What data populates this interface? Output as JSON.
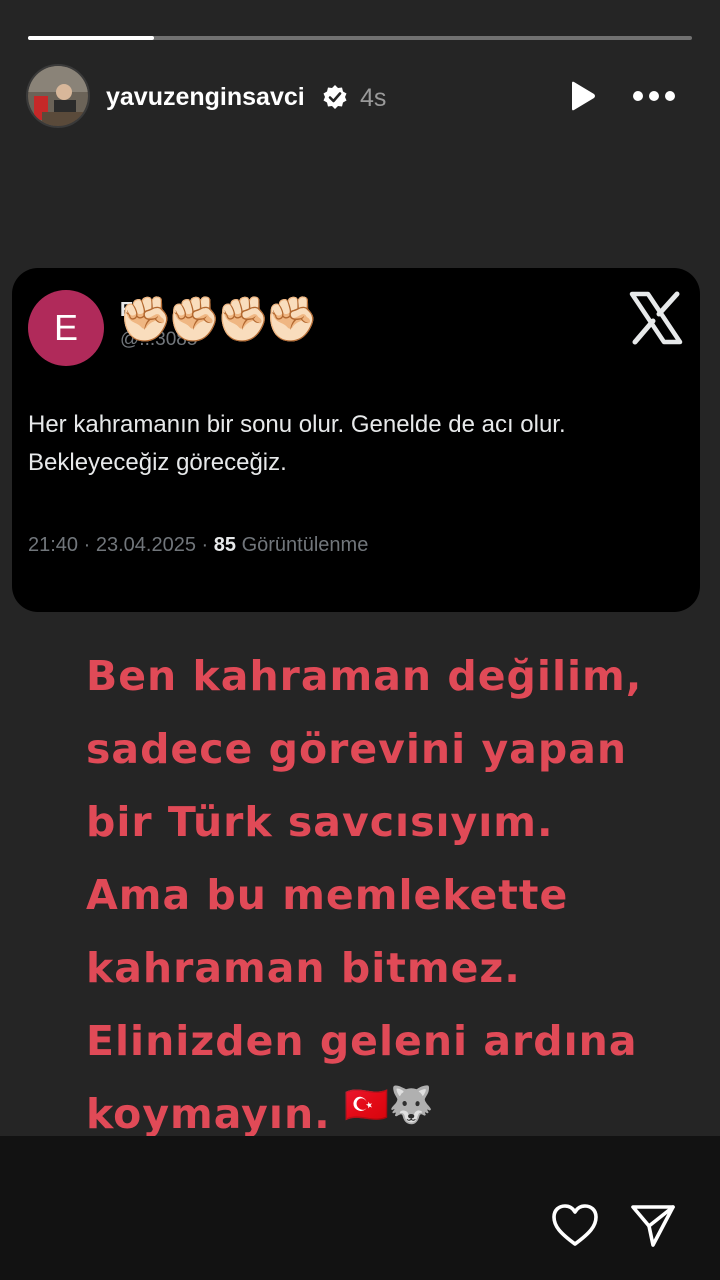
{
  "story": {
    "progress": 0.19,
    "username": "yavuzenginsavci",
    "verified": true,
    "time_ago": "4s",
    "icons": {
      "play": "play-icon",
      "more": "more-icon",
      "like": "heart-icon",
      "send": "send-icon",
      "verified": "verified-badge-icon"
    }
  },
  "tweet": {
    "avatar_letter": "E",
    "author_name": "E...",
    "handle": "@...3085",
    "emoji_overlay": "✊🏻✊🏻✊🏻✊🏻",
    "text": "Her kahramanın bir sonu olur. Genelde de acı olur. Bekleyeceğiz göreceğiz.",
    "time": "21:40",
    "date": "23.04.2025",
    "views": "85",
    "views_label": "Görüntülenme",
    "separator": "·",
    "brand_icon": "x-logo-icon",
    "avatar_color": "#b02a5a"
  },
  "caption": {
    "text": "Ben kahraman değilim,\nsadece görevini yapan\nbir Türk savcısıyım.\nAma bu memlekette\nkahraman bitmez.\nElinizden geleni ardına\nkoymayın.",
    "emoji": "🇹🇷🐺",
    "color": "#e04a57"
  }
}
